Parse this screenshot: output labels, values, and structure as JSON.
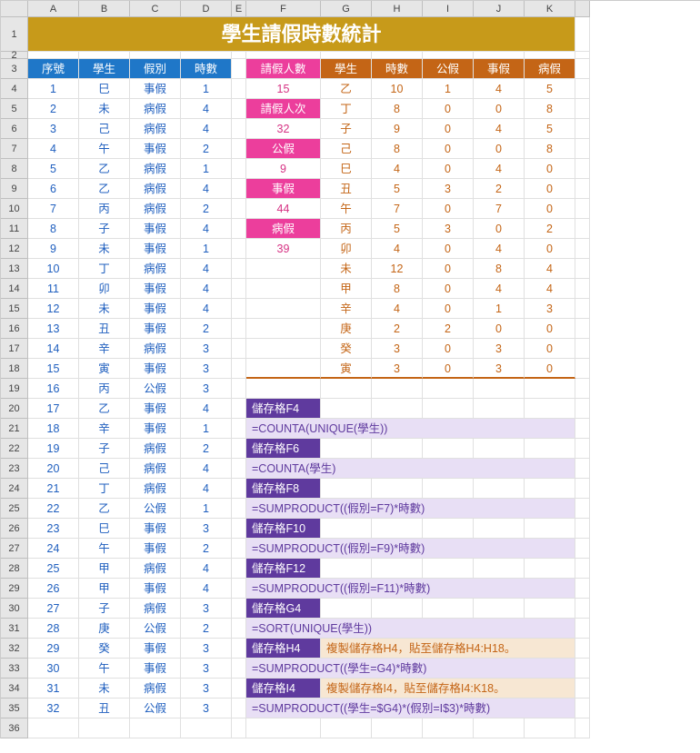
{
  "title": "學生請假時數統計",
  "colLetters": [
    "A",
    "B",
    "C",
    "D",
    "E",
    "F",
    "G",
    "H",
    "I",
    "J",
    "K"
  ],
  "leftHeaders": [
    "序號",
    "學生",
    "假別",
    "時數"
  ],
  "leftRows": [
    [
      1,
      "巳",
      "事假",
      1
    ],
    [
      2,
      "未",
      "病假",
      4
    ],
    [
      3,
      "己",
      "病假",
      4
    ],
    [
      4,
      "午",
      "事假",
      2
    ],
    [
      5,
      "乙",
      "病假",
      1
    ],
    [
      6,
      "乙",
      "病假",
      4
    ],
    [
      7,
      "丙",
      "病假",
      2
    ],
    [
      8,
      "子",
      "事假",
      4
    ],
    [
      9,
      "未",
      "事假",
      1
    ],
    [
      10,
      "丁",
      "病假",
      4
    ],
    [
      11,
      "卯",
      "事假",
      4
    ],
    [
      12,
      "未",
      "事假",
      4
    ],
    [
      13,
      "丑",
      "事假",
      2
    ],
    [
      14,
      "辛",
      "病假",
      3
    ],
    [
      15,
      "寅",
      "事假",
      3
    ],
    [
      16,
      "丙",
      "公假",
      3
    ],
    [
      17,
      "乙",
      "事假",
      4
    ],
    [
      18,
      "辛",
      "事假",
      1
    ],
    [
      19,
      "子",
      "病假",
      2
    ],
    [
      20,
      "己",
      "病假",
      4
    ],
    [
      21,
      "丁",
      "病假",
      4
    ],
    [
      22,
      "乙",
      "公假",
      1
    ],
    [
      23,
      "巳",
      "事假",
      3
    ],
    [
      24,
      "午",
      "事假",
      2
    ],
    [
      25,
      "甲",
      "病假",
      4
    ],
    [
      26,
      "甲",
      "事假",
      4
    ],
    [
      27,
      "子",
      "病假",
      3
    ],
    [
      28,
      "庚",
      "公假",
      2
    ],
    [
      29,
      "癸",
      "事假",
      3
    ],
    [
      30,
      "午",
      "事假",
      3
    ],
    [
      31,
      "未",
      "病假",
      3
    ],
    [
      32,
      "丑",
      "公假",
      3
    ]
  ],
  "midLabels": [
    "請假人數",
    "請假人次",
    "公假",
    "事假",
    "病假"
  ],
  "midValues": [
    15,
    32,
    9,
    44,
    39
  ],
  "rightHeaders": [
    "學生",
    "時數",
    "公假",
    "事假",
    "病假"
  ],
  "rightRows": [
    [
      "乙",
      10,
      1,
      4,
      5
    ],
    [
      "丁",
      8,
      0,
      0,
      8
    ],
    [
      "子",
      9,
      0,
      4,
      5
    ],
    [
      "己",
      8,
      0,
      0,
      8
    ],
    [
      "巳",
      4,
      0,
      4,
      0
    ],
    [
      "丑",
      5,
      3,
      2,
      0
    ],
    [
      "午",
      7,
      0,
      7,
      0
    ],
    [
      "丙",
      5,
      3,
      0,
      2
    ],
    [
      "卯",
      4,
      0,
      4,
      0
    ],
    [
      "未",
      12,
      0,
      8,
      4
    ],
    [
      "甲",
      8,
      0,
      4,
      4
    ],
    [
      "辛",
      4,
      0,
      1,
      3
    ],
    [
      "庚",
      2,
      2,
      0,
      0
    ],
    [
      "癸",
      3,
      0,
      3,
      0
    ],
    [
      "寅",
      3,
      0,
      3,
      0
    ]
  ],
  "formulas": [
    {
      "label": "儲存格F4",
      "formula": "=COUNTA(UNIQUE(學生))",
      "note": ""
    },
    {
      "label": "儲存格F6",
      "formula": "=COUNTA(學生)",
      "note": ""
    },
    {
      "label": "儲存格F8",
      "formula": "=SUMPRODUCT((假別=F7)*時數)",
      "note": ""
    },
    {
      "label": "儲存格F10",
      "formula": "=SUMPRODUCT((假別=F9)*時數)",
      "note": ""
    },
    {
      "label": "儲存格F12",
      "formula": "=SUMPRODUCT((假別=F11)*時數)",
      "note": ""
    },
    {
      "label": "儲存格G4",
      "formula": "=SORT(UNIQUE(學生))",
      "note": ""
    },
    {
      "label": "儲存格H4",
      "formula": "=SUMPRODUCT((學生=G4)*時數)",
      "note": "複製儲存格H4，貼至儲存格H4:H18。"
    },
    {
      "label": "儲存格I4",
      "formula": "=SUMPRODUCT((學生=$G4)*(假別=I$3)*時數)",
      "note": "複製儲存格I4，貼至儲存格I4:K18。"
    }
  ],
  "chart_data": {
    "type": "table",
    "title": "學生請假時數統計",
    "headers": [
      "學生",
      "時數",
      "公假",
      "事假",
      "病假"
    ],
    "rows": [
      [
        "乙",
        10,
        1,
        4,
        5
      ],
      [
        "丁",
        8,
        0,
        0,
        8
      ],
      [
        "子",
        9,
        0,
        4,
        5
      ],
      [
        "己",
        8,
        0,
        0,
        8
      ],
      [
        "巳",
        4,
        0,
        4,
        0
      ],
      [
        "丑",
        5,
        3,
        2,
        0
      ],
      [
        "午",
        7,
        0,
        7,
        0
      ],
      [
        "丙",
        5,
        3,
        0,
        2
      ],
      [
        "卯",
        4,
        0,
        4,
        0
      ],
      [
        "未",
        12,
        0,
        8,
        4
      ],
      [
        "甲",
        8,
        0,
        4,
        4
      ],
      [
        "辛",
        4,
        0,
        1,
        3
      ],
      [
        "庚",
        2,
        2,
        0,
        0
      ],
      [
        "癸",
        3,
        0,
        3,
        0
      ],
      [
        "寅",
        3,
        0,
        3,
        0
      ]
    ]
  }
}
